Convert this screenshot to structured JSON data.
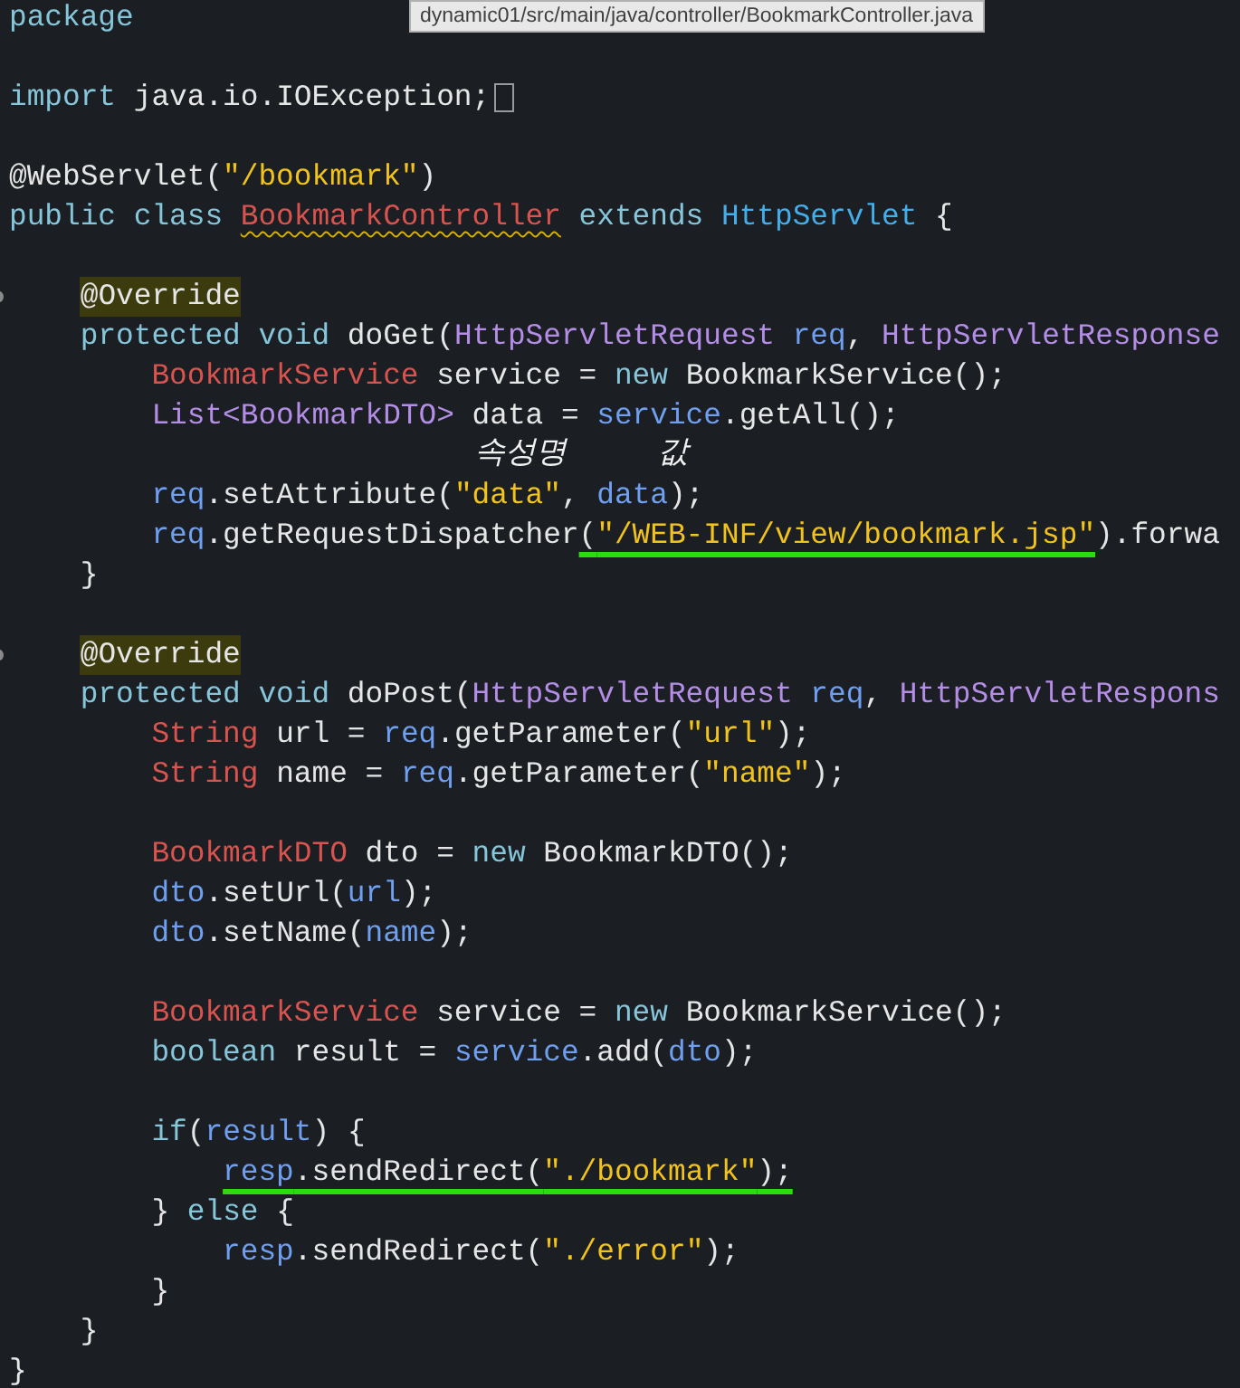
{
  "tooltip": {
    "text": "dynamic01/src/main/java/controller/BookmarkController.java"
  },
  "lines": [
    {
      "kind": "code",
      "tokens": [
        {
          "text": "package",
          "kind": "keyword"
        }
      ]
    },
    {
      "kind": "blank"
    },
    {
      "kind": "code",
      "collapsed": true,
      "tokens": [
        {
          "text": "import",
          "kind": "keyword"
        },
        {
          "text": " java.io.IOException;",
          "kind": "plain"
        }
      ]
    },
    {
      "kind": "blank"
    },
    {
      "kind": "code",
      "tokens": [
        {
          "text": "@WebServlet(",
          "kind": "plain"
        },
        {
          "text": "\"/bookmark\"",
          "kind": "string"
        },
        {
          "text": ")",
          "kind": "plain"
        }
      ]
    },
    {
      "kind": "code",
      "tokens": [
        {
          "text": "public class ",
          "kind": "keyword"
        },
        {
          "text": "BookmarkController",
          "kind": "type",
          "squiggle": true
        },
        {
          "text": " extends ",
          "kind": "keyword"
        },
        {
          "text": "HttpServlet",
          "kind": "supertype"
        },
        {
          "text": " {",
          "kind": "plain"
        }
      ]
    },
    {
      "kind": "blank"
    },
    {
      "kind": "code",
      "fold_marker": true,
      "tokens": [
        {
          "text": "    @Override",
          "kind": "plain",
          "highlighted": true
        }
      ]
    },
    {
      "kind": "code",
      "tokens": [
        {
          "text": "    protected void ",
          "kind": "keyword"
        },
        {
          "text": "doGet(",
          "kind": "plain"
        },
        {
          "text": "HttpServletRequest",
          "kind": "class"
        },
        {
          "text": " req",
          "kind": "variable"
        },
        {
          "text": ", ",
          "kind": "plain"
        },
        {
          "text": "HttpServletResponse",
          "kind": "class"
        }
      ]
    },
    {
      "kind": "code",
      "tokens": [
        {
          "text": "        BookmarkService",
          "kind": "type"
        },
        {
          "text": " service = ",
          "kind": "plain"
        },
        {
          "text": "new",
          "kind": "keyword"
        },
        {
          "text": " BookmarkService();",
          "kind": "plain"
        }
      ]
    },
    {
      "kind": "code",
      "tokens": [
        {
          "text": "        List<BookmarkDTO>",
          "kind": "class"
        },
        {
          "text": " data = ",
          "kind": "plain"
        },
        {
          "text": "service",
          "kind": "variable"
        },
        {
          "text": ".getAll();",
          "kind": "plain"
        }
      ]
    },
    {
      "kind": "note",
      "notes": [
        "속성명",
        "값"
      ]
    },
    {
      "kind": "code",
      "tokens": [
        {
          "text": "        req",
          "kind": "variable"
        },
        {
          "text": ".setAttribute(",
          "kind": "plain"
        },
        {
          "text": "\"data\"",
          "kind": "string"
        },
        {
          "text": ", ",
          "kind": "plain"
        },
        {
          "text": "data",
          "kind": "variable"
        },
        {
          "text": ");",
          "kind": "plain"
        }
      ]
    },
    {
      "kind": "code",
      "tokens": [
        {
          "text": "        req",
          "kind": "variable"
        },
        {
          "text": ".getRequestDispatcher",
          "kind": "plain"
        },
        {
          "text": "(",
          "kind": "plain",
          "marked": true
        },
        {
          "text": "\"/WEB-INF/view/bookmark.jsp\"",
          "kind": "string",
          "marked": true
        },
        {
          "text": ").forwa",
          "kind": "plain"
        }
      ]
    },
    {
      "kind": "code",
      "tokens": [
        {
          "text": "    }",
          "kind": "plain"
        }
      ]
    },
    {
      "kind": "blank"
    },
    {
      "kind": "code",
      "fold_marker": true,
      "tokens": [
        {
          "text": "    @Override",
          "kind": "plain",
          "highlighted": true
        }
      ]
    },
    {
      "kind": "code",
      "tokens": [
        {
          "text": "    protected void ",
          "kind": "keyword"
        },
        {
          "text": "doPost(",
          "kind": "plain"
        },
        {
          "text": "HttpServletRequest",
          "kind": "class"
        },
        {
          "text": " req",
          "kind": "variable"
        },
        {
          "text": ", ",
          "kind": "plain"
        },
        {
          "text": "HttpServletRespons",
          "kind": "class"
        }
      ]
    },
    {
      "kind": "code",
      "tokens": [
        {
          "text": "        String",
          "kind": "type"
        },
        {
          "text": " url = ",
          "kind": "plain"
        },
        {
          "text": "req",
          "kind": "variable"
        },
        {
          "text": ".getParameter(",
          "kind": "plain"
        },
        {
          "text": "\"url\"",
          "kind": "string"
        },
        {
          "text": ");",
          "kind": "plain"
        }
      ]
    },
    {
      "kind": "code",
      "tokens": [
        {
          "text": "        String",
          "kind": "type"
        },
        {
          "text": " name = ",
          "kind": "plain"
        },
        {
          "text": "req",
          "kind": "variable"
        },
        {
          "text": ".getParameter(",
          "kind": "plain"
        },
        {
          "text": "\"name\"",
          "kind": "string"
        },
        {
          "text": ");",
          "kind": "plain"
        }
      ]
    },
    {
      "kind": "blank"
    },
    {
      "kind": "code",
      "tokens": [
        {
          "text": "        BookmarkDTO",
          "kind": "type"
        },
        {
          "text": " dto = ",
          "kind": "plain"
        },
        {
          "text": "new",
          "kind": "keyword"
        },
        {
          "text": " BookmarkDTO();",
          "kind": "plain"
        }
      ]
    },
    {
      "kind": "code",
      "tokens": [
        {
          "text": "        dto",
          "kind": "variable"
        },
        {
          "text": ".setUrl(",
          "kind": "plain"
        },
        {
          "text": "url",
          "kind": "variable"
        },
        {
          "text": ");",
          "kind": "plain"
        }
      ]
    },
    {
      "kind": "code",
      "tokens": [
        {
          "text": "        dto",
          "kind": "variable"
        },
        {
          "text": ".setName(",
          "kind": "plain"
        },
        {
          "text": "name",
          "kind": "variable"
        },
        {
          "text": ");",
          "kind": "plain"
        }
      ]
    },
    {
      "kind": "blank"
    },
    {
      "kind": "code",
      "tokens": [
        {
          "text": "        BookmarkService",
          "kind": "type"
        },
        {
          "text": " service = ",
          "kind": "plain"
        },
        {
          "text": "new",
          "kind": "keyword"
        },
        {
          "text": " BookmarkService();",
          "kind": "plain"
        }
      ]
    },
    {
      "kind": "code",
      "tokens": [
        {
          "text": "        boolean",
          "kind": "keyword"
        },
        {
          "text": " result = ",
          "kind": "plain"
        },
        {
          "text": "service",
          "kind": "variable"
        },
        {
          "text": ".add(",
          "kind": "plain"
        },
        {
          "text": "dto",
          "kind": "variable"
        },
        {
          "text": ");",
          "kind": "plain"
        }
      ]
    },
    {
      "kind": "blank"
    },
    {
      "kind": "code",
      "tokens": [
        {
          "text": "        if",
          "kind": "keyword"
        },
        {
          "text": "(",
          "kind": "plain"
        },
        {
          "text": "result",
          "kind": "variable"
        },
        {
          "text": ") {",
          "kind": "plain"
        }
      ]
    },
    {
      "kind": "code",
      "tokens": [
        {
          "text": "            resp",
          "kind": "variable",
          "marked": true
        },
        {
          "text": ".sendRedirect(",
          "kind": "plain",
          "marked": true
        },
        {
          "text": "\"./bookmark\"",
          "kind": "string",
          "marked": true
        },
        {
          "text": ");",
          "kind": "plain",
          "marked": true
        }
      ]
    },
    {
      "kind": "code",
      "tokens": [
        {
          "text": "        } ",
          "kind": "plain"
        },
        {
          "text": "else",
          "kind": "keyword"
        },
        {
          "text": " {",
          "kind": "plain"
        }
      ]
    },
    {
      "kind": "code",
      "tokens": [
        {
          "text": "            resp",
          "kind": "variable"
        },
        {
          "text": ".sendRedirect(",
          "kind": "plain"
        },
        {
          "text": "\"./error\"",
          "kind": "string"
        },
        {
          "text": ");",
          "kind": "plain"
        }
      ]
    },
    {
      "kind": "code",
      "tokens": [
        {
          "text": "        }",
          "kind": "plain"
        }
      ]
    },
    {
      "kind": "code",
      "tokens": [
        {
          "text": "    }",
          "kind": "plain"
        }
      ]
    },
    {
      "kind": "code",
      "tokens": [
        {
          "text": "}",
          "kind": "plain"
        }
      ]
    }
  ]
}
